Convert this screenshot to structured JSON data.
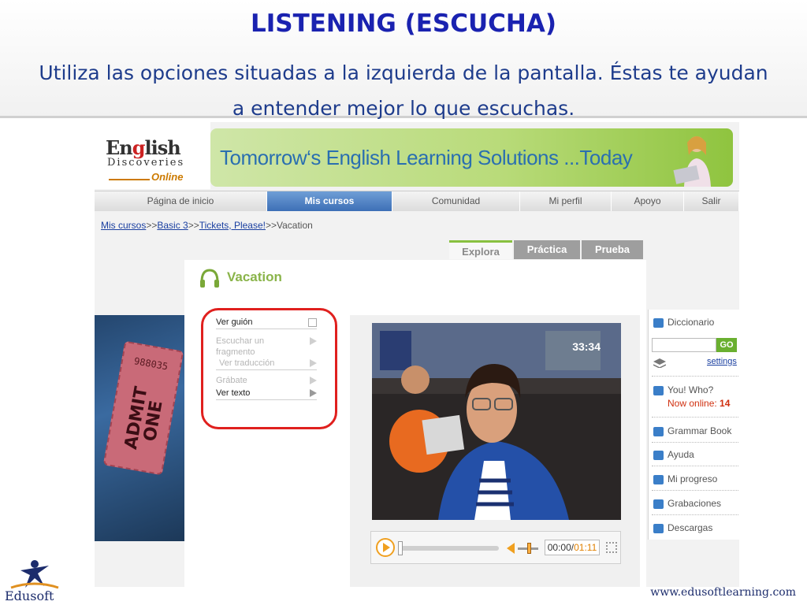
{
  "slide": {
    "title": "LISTENING (ESCUCHA)",
    "subtitle": "Utiliza las opciones situadas a la izquierda de la pantalla. Éstas te ayudan a entender mejor lo que escuchas."
  },
  "logo": {
    "english_pre": "En",
    "english_g": "g",
    "english_post": "lish",
    "discoveries": "Discoveries",
    "online": "Online"
  },
  "banner": {
    "text": "Tomorrow‘s English Learning Solutions ...Today"
  },
  "nav": {
    "items": [
      {
        "label": "Página de inicio"
      },
      {
        "label": "Mis cursos"
      },
      {
        "label": "Comunidad"
      },
      {
        "label": "Mi perfil"
      },
      {
        "label": "Apoyo"
      },
      {
        "label": "Salir"
      }
    ],
    "active": "Mis cursos"
  },
  "breadcrumb": {
    "links": [
      "Mis cursos",
      "Basic 3",
      "Tickets, Please!"
    ],
    "separator": ">>",
    "current": "Vacation"
  },
  "tabs": [
    {
      "label": "Explora"
    },
    {
      "label": "Práctica"
    },
    {
      "label": "Prueba"
    }
  ],
  "ticket": {
    "number": "988035",
    "text": "ADMIT ONE"
  },
  "panel": {
    "title": "Vacation"
  },
  "tools": [
    {
      "label": "Ver guión"
    },
    {
      "label": "Escuchar un"
    },
    {
      "label": "fragmento"
    },
    {
      "label": "Ver traducción"
    },
    {
      "label": "Grábate"
    },
    {
      "label": "Ver texto"
    }
  ],
  "video": {
    "timestamp": "33:34",
    "current_time": "00:00",
    "duration": "01:11"
  },
  "sidebar": {
    "dictionary": "Diccionario",
    "go": "GO",
    "settings": "settings",
    "you_who": "You! Who?",
    "now_online_label": "Now online:",
    "now_online_count": "14",
    "grammar": "Grammar Book",
    "help": "Ayuda",
    "progress": "Mi progreso",
    "recordings": "Grabaciones",
    "downloads": "Descargas"
  },
  "footer": {
    "brand": "Edusoft",
    "website": "www.edusoftlearning.com"
  },
  "colors": {
    "title": "#1a22b0",
    "nav_active": "#3d6fb6",
    "accent_green": "#8ab44a",
    "highlight_red": "#e0201e"
  }
}
